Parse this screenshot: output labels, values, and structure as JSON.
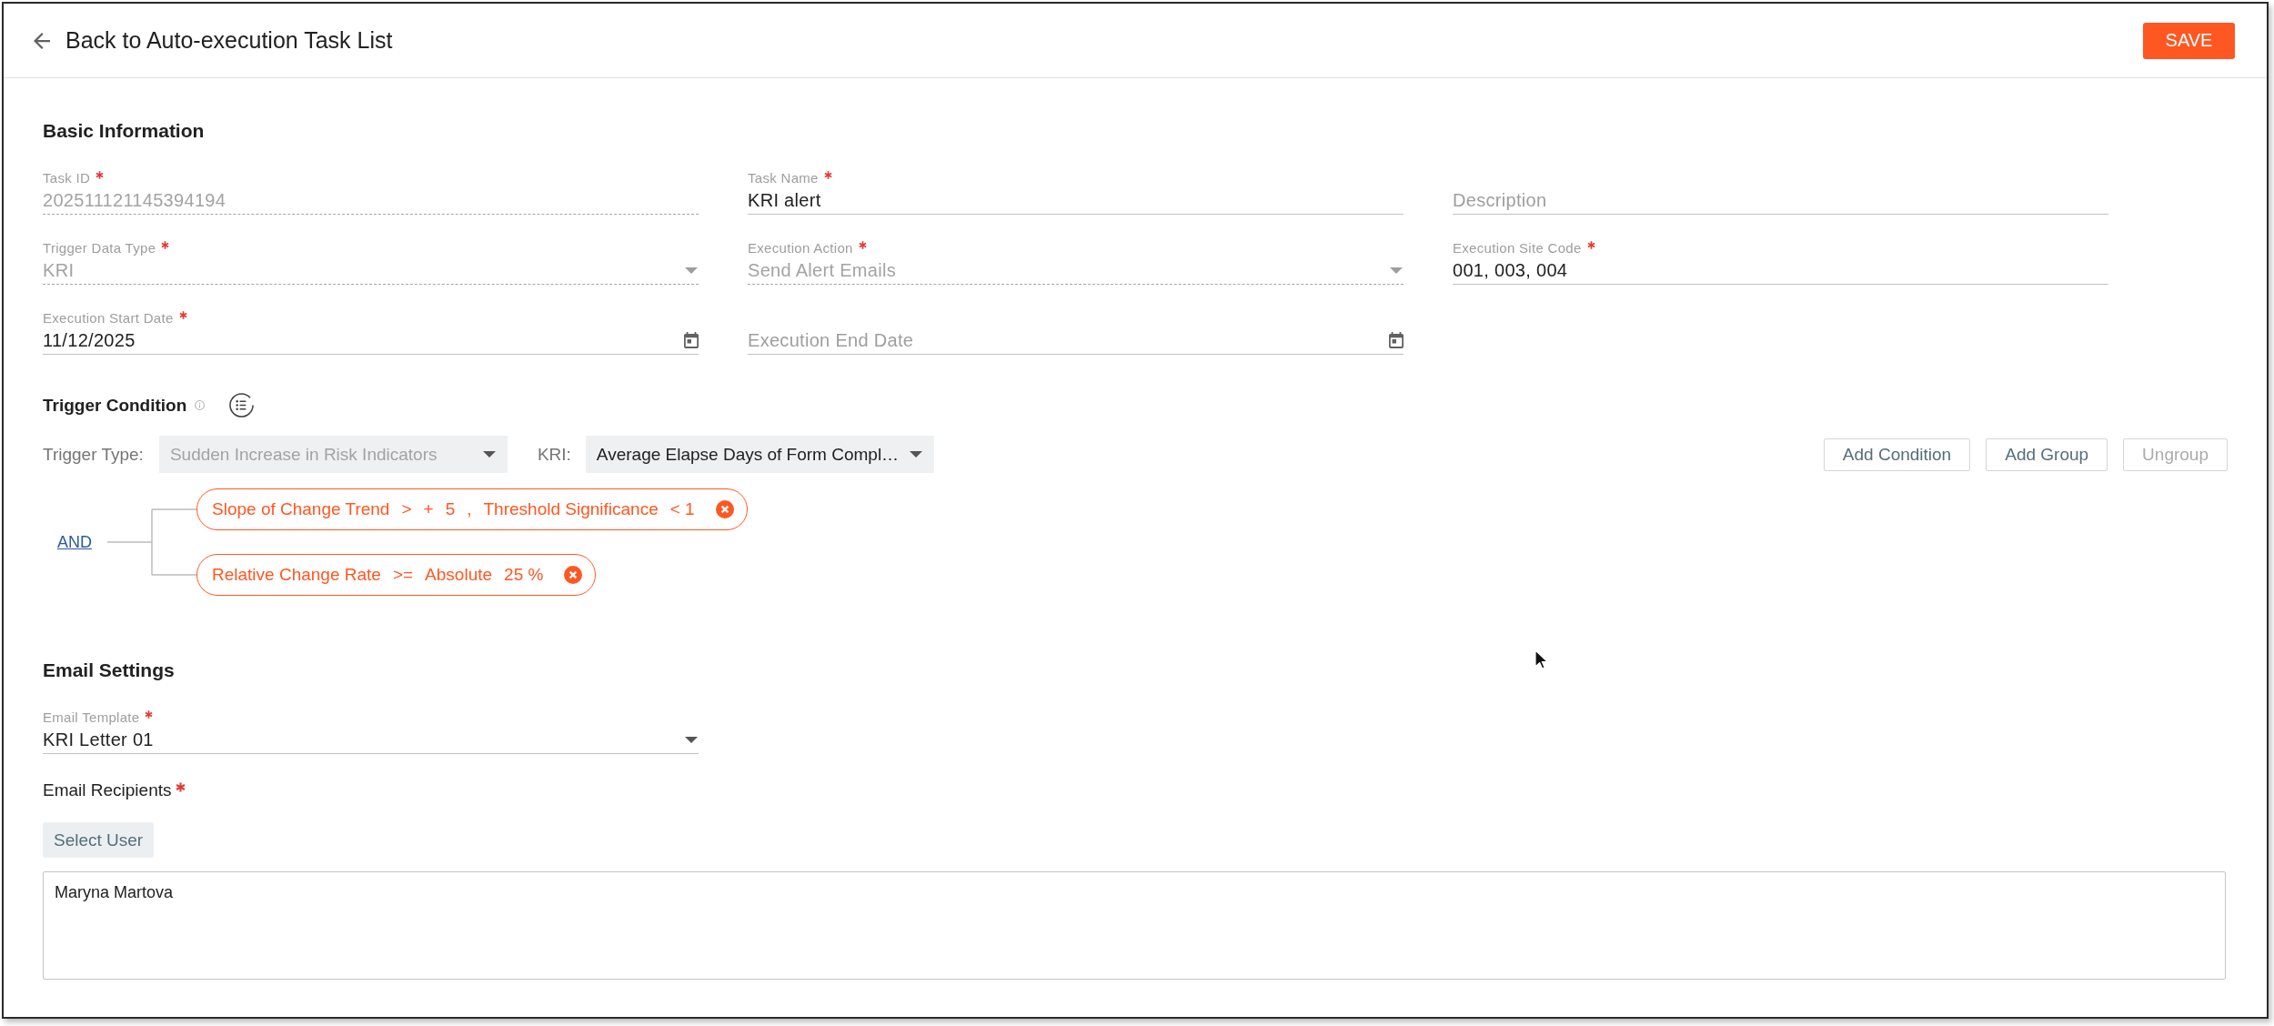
{
  "header": {
    "back_label": "Back to Auto-execution Task List",
    "save_label": "SAVE"
  },
  "basic_information": {
    "title": "Basic Information",
    "fields": [
      {
        "kind": "text",
        "label": "Task ID",
        "required": true,
        "disabled": true,
        "value": "202511121145394194"
      },
      {
        "kind": "text",
        "label": "Task Name",
        "required": true,
        "disabled": false,
        "value": "KRI alert"
      },
      {
        "kind": "text",
        "placeholder": "Description",
        "required": false,
        "disabled": false
      },
      {
        "kind": "select",
        "label": "Trigger Data Type",
        "required": true,
        "disabled": true,
        "value": "KRI"
      },
      {
        "kind": "select",
        "label": "Execution Action",
        "required": true,
        "disabled": true,
        "value": "Send Alert Emails"
      },
      {
        "kind": "text",
        "label": "Execution Site Code",
        "required": true,
        "disabled": false,
        "value": "001, 003, 004"
      },
      {
        "kind": "date",
        "label": "Execution Start Date",
        "required": true,
        "disabled": false,
        "value": "11/12/2025"
      },
      {
        "kind": "date",
        "placeholder": "Execution End Date",
        "required": false,
        "disabled": false
      }
    ]
  },
  "trigger_condition": {
    "title": "Trigger Condition",
    "trigger_type": {
      "label": "Trigger Type:",
      "value": "Sudden Increase in Risk Indicators",
      "disabled": true
    },
    "kri": {
      "label": "KRI:",
      "value": "Average Elapse Days of Form Compl…",
      "disabled": false
    },
    "buttons": [
      {
        "label": "Add Condition",
        "disabled": false
      },
      {
        "label": "Add Group",
        "disabled": false
      },
      {
        "label": "Ungroup",
        "disabled": true
      }
    ],
    "group": {
      "operator": "AND",
      "conditions": [
        {
          "tokens": [
            "Slope of Change Trend",
            ">",
            "+",
            "5",
            ",",
            "Threshold Significance",
            "< 1"
          ]
        },
        {
          "tokens": [
            "Relative Change Rate",
            ">=",
            "Absolute",
            "25 %"
          ]
        }
      ]
    }
  },
  "email_settings": {
    "title": "Email Settings",
    "template": {
      "kind": "select",
      "label": "Email Template",
      "required": true,
      "disabled": false,
      "value": "KRI Letter 01"
    },
    "recipients": {
      "label": "Email Recipients",
      "required": true,
      "button": "Select User",
      "value": "Maryna Martova"
    }
  }
}
